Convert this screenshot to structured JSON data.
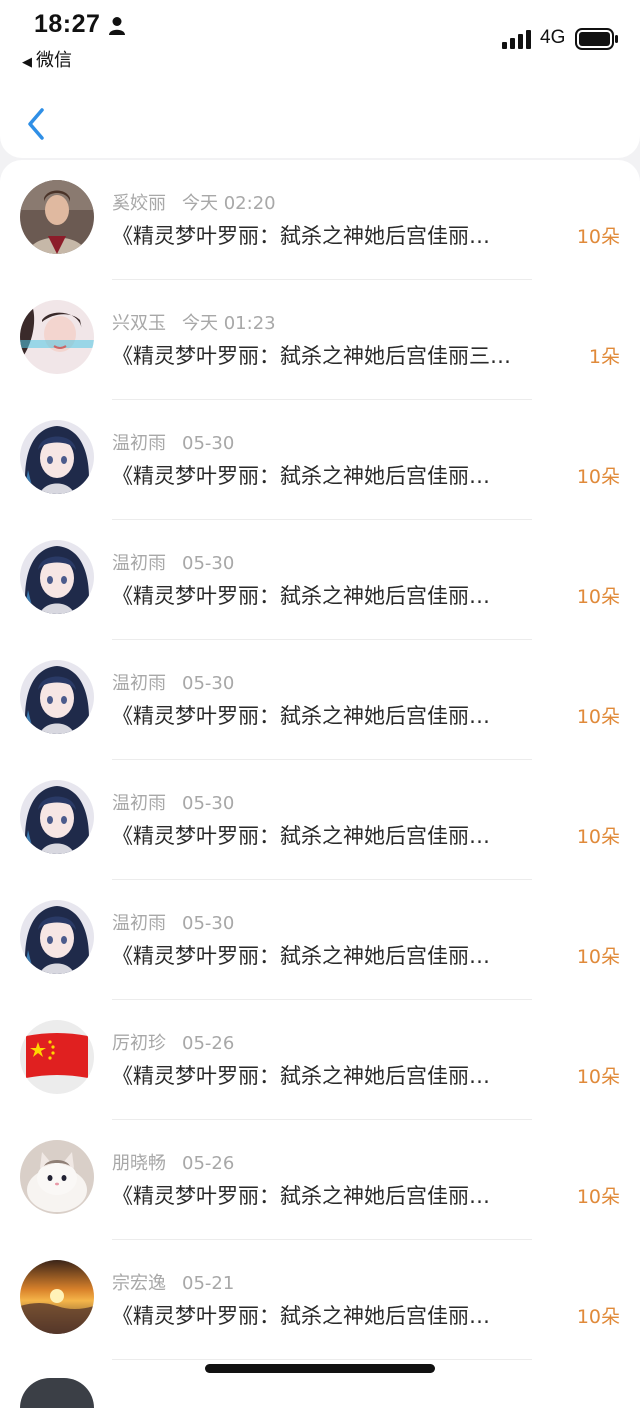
{
  "status_bar": {
    "time": "18:27",
    "back_app": "微信",
    "network": "4G"
  },
  "nav": {
    "back_icon": "chevron-left-icon",
    "accent_color": "#2f8fe6"
  },
  "list": {
    "items": [
      {
        "name": "奚姣丽",
        "time": "今天 02:20",
        "message": "《精灵梦叶罗丽：弑杀之神她后宫佳丽…",
        "count": "10朵",
        "avatar": "photo-man"
      },
      {
        "name": "兴双玉",
        "time": "今天 01:23",
        "message": "《精灵梦叶罗丽：弑杀之神她后宫佳丽三…",
        "count": "1朵",
        "avatar": "photo-girl"
      },
      {
        "name": "温初雨",
        "time": "05-30",
        "message": "《精灵梦叶罗丽：弑杀之神她后宫佳丽…",
        "count": "10朵",
        "avatar": "anime-girl"
      },
      {
        "name": "温初雨",
        "time": "05-30",
        "message": "《精灵梦叶罗丽：弑杀之神她后宫佳丽…",
        "count": "10朵",
        "avatar": "anime-girl"
      },
      {
        "name": "温初雨",
        "time": "05-30",
        "message": "《精灵梦叶罗丽：弑杀之神她后宫佳丽…",
        "count": "10朵",
        "avatar": "anime-girl"
      },
      {
        "name": "温初雨",
        "time": "05-30",
        "message": "《精灵梦叶罗丽：弑杀之神她后宫佳丽…",
        "count": "10朵",
        "avatar": "anime-girl"
      },
      {
        "name": "温初雨",
        "time": "05-30",
        "message": "《精灵梦叶罗丽：弑杀之神她后宫佳丽…",
        "count": "10朵",
        "avatar": "anime-girl"
      },
      {
        "name": "厉初珍",
        "time": "05-26",
        "message": "《精灵梦叶罗丽：弑杀之神她后宫佳丽…",
        "count": "10朵",
        "avatar": "china-flag"
      },
      {
        "name": "朋晓畅",
        "time": "05-26",
        "message": "《精灵梦叶罗丽：弑杀之神她后宫佳丽…",
        "count": "10朵",
        "avatar": "white-cat"
      },
      {
        "name": "宗宏逸",
        "time": "05-21",
        "message": "《精灵梦叶罗丽：弑杀之神她后宫佳丽…",
        "count": "10朵",
        "avatar": "sunset"
      }
    ]
  },
  "colors": {
    "count": "#e08a3a",
    "meta": "#a8a8a8",
    "text": "#2a2a2a"
  }
}
